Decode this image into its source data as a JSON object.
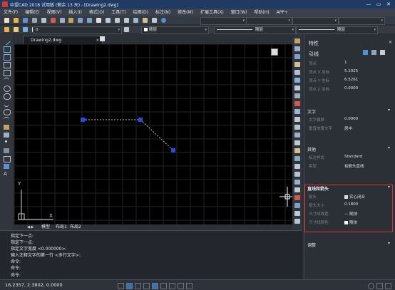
{
  "window": {
    "title": "中望CAD 2018 试用版 (剩余 13 天) - [Drawing2.dwg]",
    "min_label": "—",
    "max_label": "▭",
    "close_label": "✕"
  },
  "menu": [
    "文件(F)",
    "编辑(E)",
    "视图(V)",
    "插入(I)",
    "格式(O)",
    "工具(T)",
    "绘图(D)",
    "标注(N)",
    "修改(M)",
    "扩展工具(X)",
    "窗口(W)",
    "帮助(H)",
    "APP+"
  ],
  "toolbar": {
    "layer_value": "0",
    "color_value": "随层",
    "linetype_value": "随层",
    "lineweight_value": "随层"
  },
  "doc_tab": {
    "label": "Drawing2.dwg",
    "close": "✕"
  },
  "layout_tabs": [
    "模型",
    "布局1",
    "布局2"
  ],
  "ucs": {
    "x_label": "X",
    "y_label": "Y"
  },
  "command_lines": [
    "指定下一点:",
    "指定下一点:",
    "指定文字宽度 <0.000000>:",
    "输入注释文字的第一行 <多行文字>:",
    "命令:",
    "命令:",
    "命令:"
  ],
  "properties": {
    "title": "特性",
    "object_type": "引线",
    "rows_basic": [
      {
        "k": "顶点",
        "v": "1"
      },
      {
        "k": "顶点 X 坐标",
        "v": "5.1925"
      },
      {
        "k": "顶点 Y 坐标",
        "v": "6.5261"
      },
      {
        "k": "顶点 Z 坐标",
        "v": "0.0000"
      }
    ],
    "section_text": "文字",
    "rows_text": [
      {
        "k": "文字偏移",
        "v": "0.0900"
      },
      {
        "k": "垂直放置文字",
        "v": "居中"
      }
    ],
    "section_misc": "其他",
    "rows_misc": [
      {
        "k": "标注样式",
        "v": "Standard"
      },
      {
        "k": "类型",
        "v": "有箭头直线"
      }
    ],
    "section_arrow": "直线和箭头",
    "rows_arrow": [
      {
        "k": "箭头",
        "v": "实心闭合"
      },
      {
        "k": "箭头大小",
        "v": "0.1800"
      },
      {
        "k": "尺寸线线宽",
        "v": "— 随块"
      },
      {
        "k": "尺寸线颜色",
        "v": "随块"
      }
    ],
    "section_adjust": "调整"
  },
  "status": {
    "coords": "16.2357, 2.3802, 0.0000"
  }
}
